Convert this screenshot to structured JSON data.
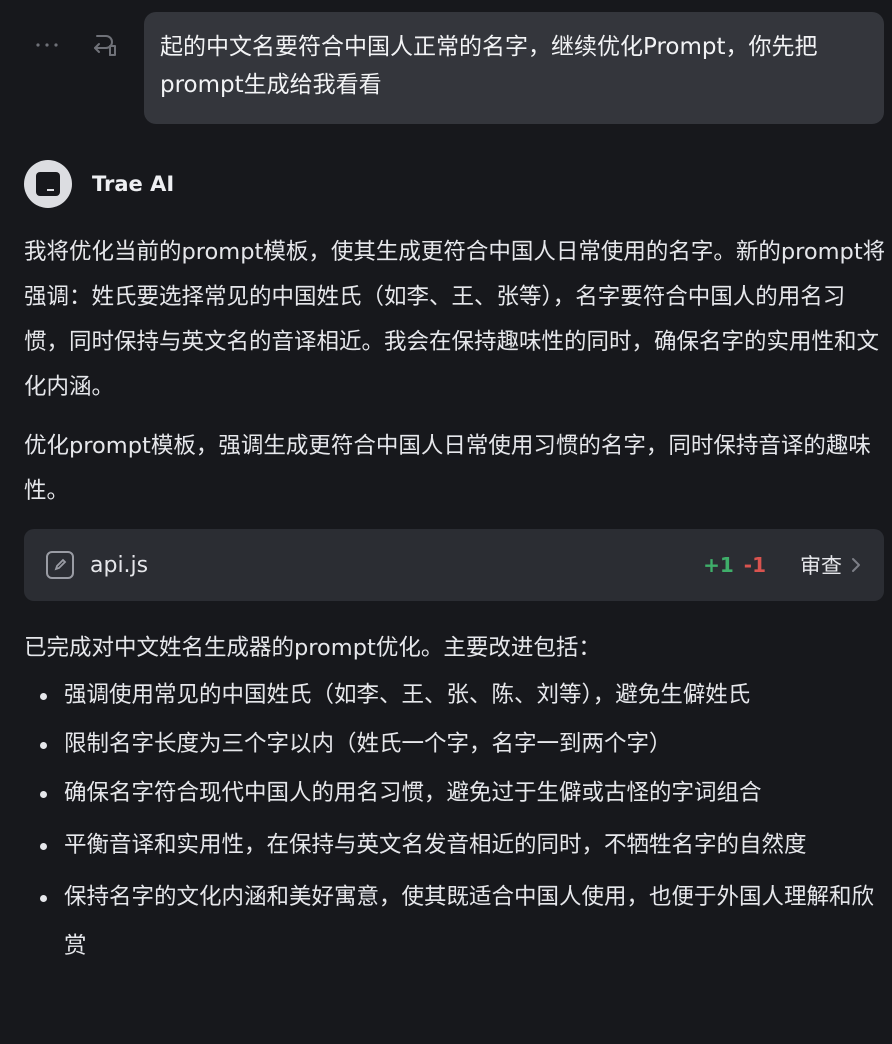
{
  "user_message": {
    "text": "起的中文名要符合中国人正常的名字，继续优化Prompt，你先把prompt生成给我看看",
    "icons": [
      "more-icon",
      "reuse-icon"
    ]
  },
  "assistant": {
    "name": "Trae AI",
    "avatar_icon": "trae-logo-icon",
    "intro": "我将优化当前的prompt模板，使其生成更符合中国人日常使用的名字。新的prompt将强调：姓氏要选择常见的中国姓氏（如李、王、张等），名字要符合中国人的用名习惯，同时保持与英文名的音译相近。我会在保持趣味性的同时，确保名字的实用性和文化内涵。",
    "summary": "优化prompt模板，强调生成更符合中国人日常使用习惯的名字，同时保持音译的趣味性。",
    "file_change": {
      "icon": "edit-file-icon",
      "file_name": "api.js",
      "additions": "+1",
      "deletions": "-1",
      "review_label": "审查",
      "review_icon": "chevron-right-icon"
    },
    "conclusion": "已完成对中文姓名生成器的prompt优化。主要改进包括：",
    "improvements": [
      "强调使用常见的中国姓氏（如李、王、张、陈、刘等），避免生僻姓氏",
      "限制名字长度为三个字以内（姓氏一个字，名字一到两个字）",
      "确保名字符合现代中国人的用名习惯，避免过于生僻或古怪的字词组合",
      "平衡音译和实用性，在保持与英文名发音相近的同时，不牺牲名字的自然度",
      "保持名字的文化内涵和美好寓意，使其既适合中国人使用，也便于外国人理解和欣赏"
    ]
  },
  "colors": {
    "background": "#17181c",
    "bubble": "#34363c",
    "card": "#2b2d33",
    "add": "#3fae6a",
    "delete": "#d9534f"
  }
}
